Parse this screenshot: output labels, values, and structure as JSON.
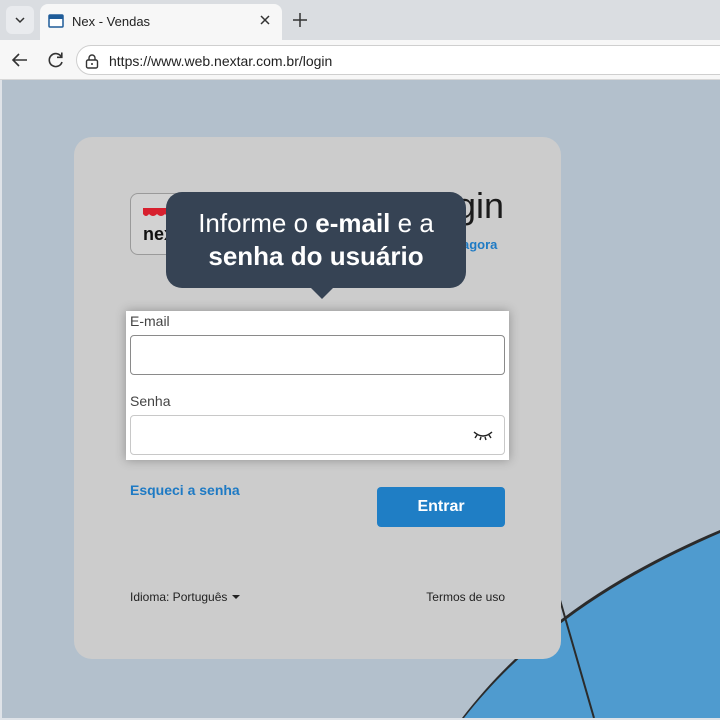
{
  "browser": {
    "tab_title": "Nex - Vendas",
    "url": "https://www.web.nextar.com.br/login"
  },
  "page": {
    "logo_text": "nex",
    "title": "Login",
    "title_visible": "gin",
    "signup_link": "agora",
    "tooltip_part1": "Informe o ",
    "tooltip_bold1": "e-mail",
    "tooltip_part2": " e a",
    "tooltip_bold2": "senha do usuário",
    "email_label": "E-mail",
    "email_value": "",
    "password_label": "Senha",
    "password_value": "",
    "forgot_link": "Esqueci a senha",
    "submit_label": "Entrar",
    "language_label": "Idioma: Português",
    "terms_link": "Termos de uso"
  },
  "colors": {
    "primary": "#1f7ec5",
    "tooltip_bg": "#364354",
    "page_bg": "#b3c0cc",
    "card_bg": "#cccccc",
    "deco_blue": "#4f9bcf"
  },
  "icons": [
    "tab-list-icon",
    "tab-favicon-icon",
    "close-icon",
    "new-tab-icon",
    "back-icon",
    "reload-icon",
    "lock-icon",
    "eye-closed-icon",
    "caret-down-icon"
  ]
}
